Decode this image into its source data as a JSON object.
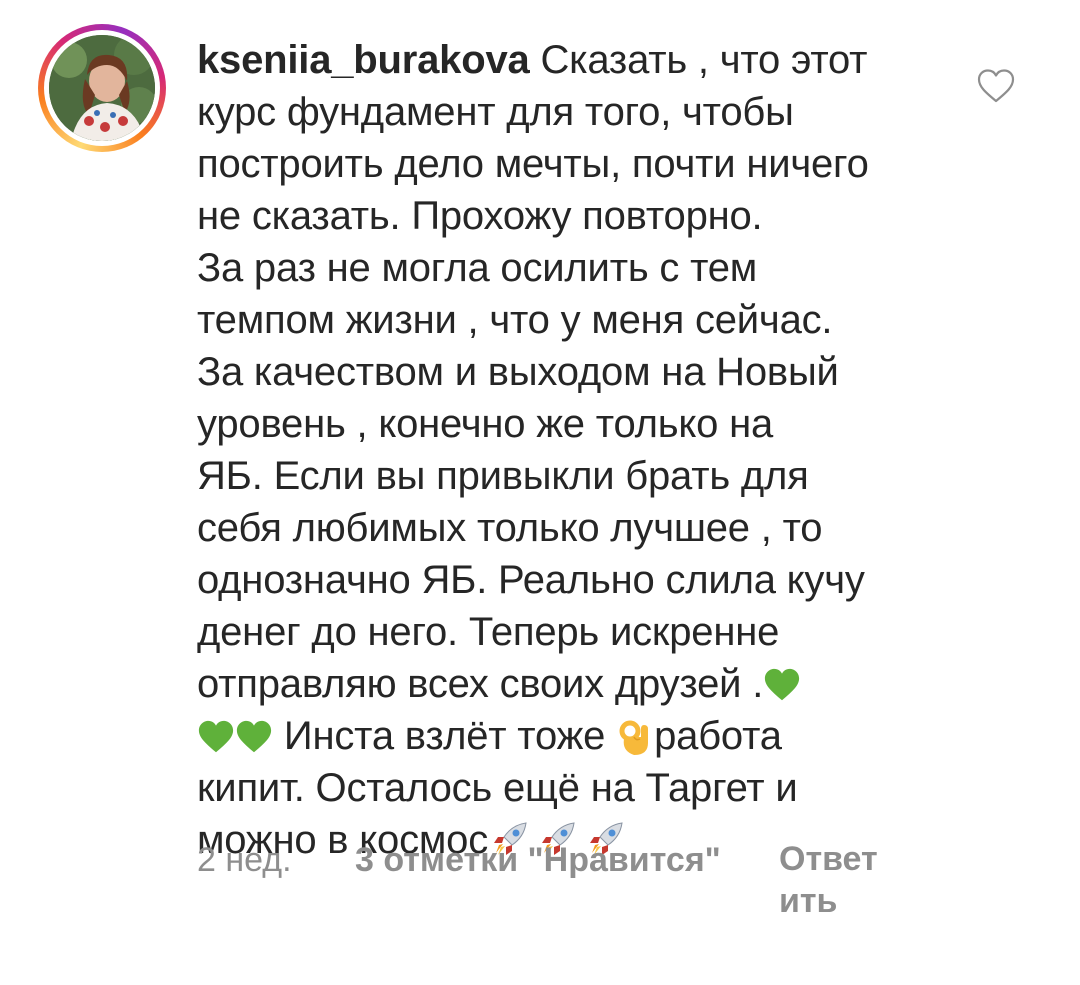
{
  "comment": {
    "username": "kseniia_burakova",
    "lines": [
      "Сказать , что этот",
      "курс фундамент для того, чтобы",
      "построить дело мечты, почти ничего",
      "не сказать. Прохожу повторно.",
      "За раз не могла осилить с тем",
      "темпом жизни , что у меня сейчас.",
      "За качеством и выходом на Новый",
      "уровень , конечно же только на",
      "ЯБ. Если вы привыкли брать для",
      "себя любимых только лучшее , то",
      "однозначно ЯБ. Реально слила кучу",
      "денег до него. Теперь искренне",
      "отправляю всех своих друзей .",
      "Инста взлёт тоже",
      "работа",
      "кипит. Осталось ещё на Таргет и",
      "можно в космос"
    ]
  },
  "meta": {
    "time": "2 нед.",
    "likes": "3 отметки \"Нравится\"",
    "reply_part1": "Ответ",
    "reply_part2": "ить"
  },
  "icons": {
    "like": "heart-outline-icon",
    "green_heart": "green-heart-emoji",
    "ok_hand": "ok-hand-emoji",
    "rocket": "rocket-emoji"
  },
  "colors": {
    "text": "#262626",
    "secondary": "#8e8e8e",
    "green_heart": "#5fb13a",
    "ok_hand": "#f7b93a"
  }
}
